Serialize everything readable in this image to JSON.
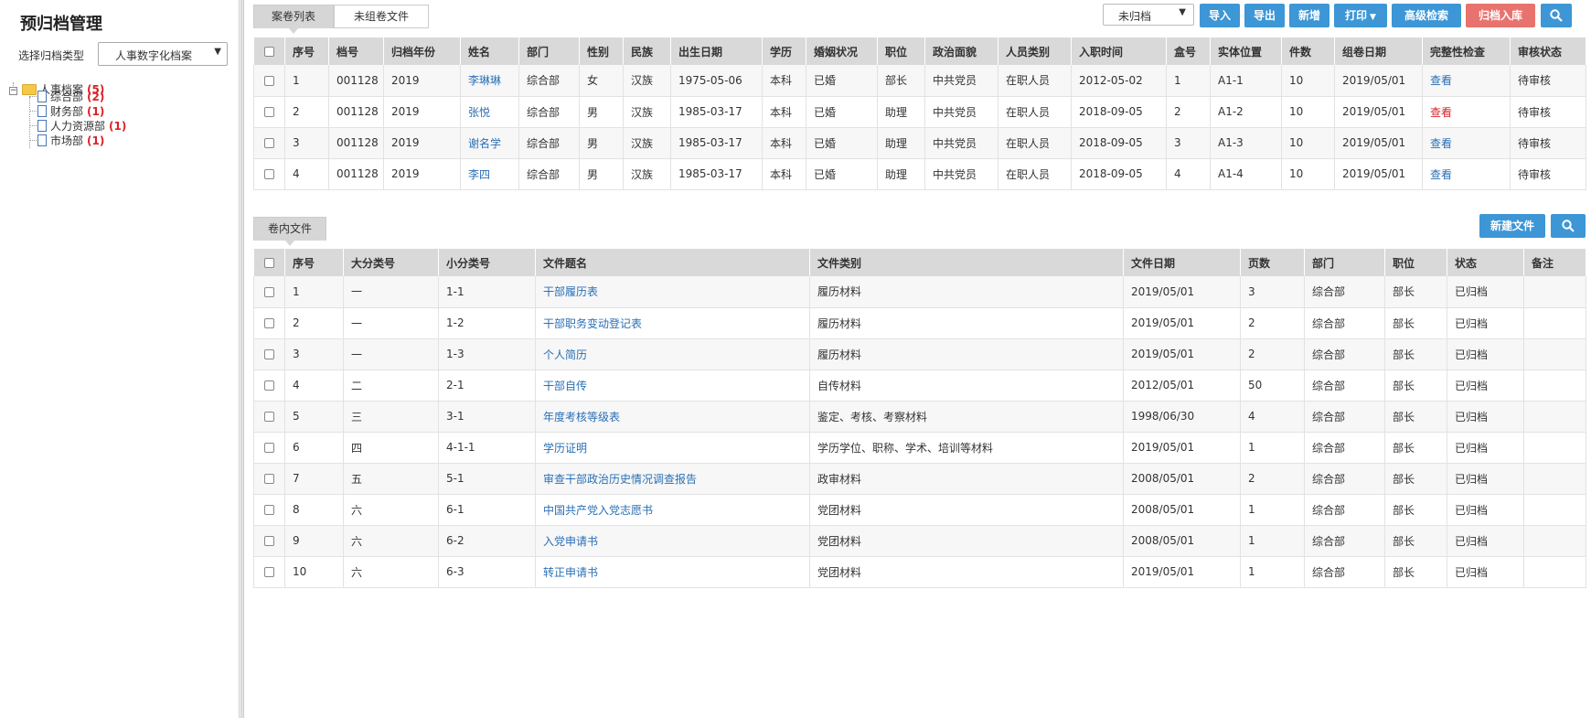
{
  "sidebar": {
    "title": "预归档管理",
    "select_label": "选择归档类型",
    "select_value": "人事数字化档案",
    "tree": {
      "root": {
        "label": "人事档案",
        "count": "(5)"
      },
      "children": [
        {
          "label": "综合部",
          "count": "(2)"
        },
        {
          "label": "财务部",
          "count": "(1)"
        },
        {
          "label": "人力资源部",
          "count": "(1)"
        },
        {
          "label": "市场部",
          "count": "(1)"
        }
      ]
    }
  },
  "top": {
    "tabs": [
      {
        "label": "案卷列表"
      },
      {
        "label": "未组卷文件"
      }
    ],
    "status_select": "未归档",
    "buttons": {
      "import": "导入",
      "export": "导出",
      "add": "新增",
      "print": "打印",
      "advanced_search": "高级检索",
      "archive": "归档入库"
    },
    "columns": [
      "序号",
      "档号",
      "归档年份",
      "姓名",
      "部门",
      "性别",
      "民族",
      "出生日期",
      "学历",
      "婚姻状况",
      "职位",
      "政治面貌",
      "人员类别",
      "入职时间",
      "盒号",
      "实体位置",
      "件数",
      "组卷日期",
      "完整性检查",
      "审核状态"
    ],
    "rows": [
      [
        "1",
        "001128",
        "2019",
        "李琳琳",
        "综合部",
        "女",
        "汉族",
        "1975-05-06",
        "本科",
        "已婚",
        "部长",
        "中共党员",
        "在职人员",
        "2012-05-02",
        "1",
        "A1-1",
        "10",
        "2019/05/01",
        "查看",
        "待审核"
      ],
      [
        "2",
        "001128",
        "2019",
        "张悦",
        "综合部",
        "男",
        "汉族",
        "1985-03-17",
        "本科",
        "已婚",
        "助理",
        "中共党员",
        "在职人员",
        "2018-09-05",
        "2",
        "A1-2",
        "10",
        "2019/05/01",
        "查看",
        "待审核"
      ],
      [
        "3",
        "001128",
        "2019",
        "谢名学",
        "综合部",
        "男",
        "汉族",
        "1985-03-17",
        "本科",
        "已婚",
        "助理",
        "中共党员",
        "在职人员",
        "2018-09-05",
        "3",
        "A1-3",
        "10",
        "2019/05/01",
        "查看",
        "待审核"
      ],
      [
        "4",
        "001128",
        "2019",
        "李四",
        "综合部",
        "男",
        "汉族",
        "1985-03-17",
        "本科",
        "已婚",
        "助理",
        "中共党员",
        "在职人员",
        "2018-09-05",
        "4",
        "A1-4",
        "10",
        "2019/05/01",
        "查看",
        "待审核"
      ]
    ]
  },
  "bottom": {
    "tab": "卷内文件",
    "new_file_button": "新建文件",
    "columns": [
      "序号",
      "大分类号",
      "小分类号",
      "文件题名",
      "文件类别",
      "文件日期",
      "页数",
      "部门",
      "职位",
      "状态",
      "备注"
    ],
    "rows": [
      [
        "1",
        "一",
        "1-1",
        "干部履历表",
        "履历材料",
        "2019/05/01",
        "3",
        "综合部",
        "部长",
        "已归档",
        ""
      ],
      [
        "2",
        "一",
        "1-2",
        "干部职务变动登记表",
        "履历材料",
        "2019/05/01",
        "2",
        "综合部",
        "部长",
        "已归档",
        ""
      ],
      [
        "3",
        "一",
        "1-3",
        "个人简历",
        "履历材料",
        "2019/05/01",
        "2",
        "综合部",
        "部长",
        "已归档",
        ""
      ],
      [
        "4",
        "二",
        "2-1",
        "干部自传",
        "自传材料",
        "2012/05/01",
        "50",
        "综合部",
        "部长",
        "已归档",
        ""
      ],
      [
        "5",
        "三",
        "3-1",
        "年度考核等级表",
        "鉴定、考核、考察材料",
        "1998/06/30",
        "4",
        "综合部",
        "部长",
        "已归档",
        ""
      ],
      [
        "6",
        "四",
        "4-1-1",
        "学历证明",
        "学历学位、职称、学术、培训等材料",
        "2019/05/01",
        "1",
        "综合部",
        "部长",
        "已归档",
        ""
      ],
      [
        "7",
        "五",
        "5-1",
        "审查干部政治历史情况调查报告",
        "政审材料",
        "2008/05/01",
        "2",
        "综合部",
        "部长",
        "已归档",
        ""
      ],
      [
        "8",
        "六",
        "6-1",
        "中国共产党入党志愿书",
        "党团材料",
        "2008/05/01",
        "1",
        "综合部",
        "部长",
        "已归档",
        ""
      ],
      [
        "9",
        "六",
        "6-2",
        "入党申请书",
        "党团材料",
        "2008/05/01",
        "1",
        "综合部",
        "部长",
        "已归档",
        ""
      ],
      [
        "10",
        "六",
        "6-3",
        "转正申请书",
        "党团材料",
        "2019/05/01",
        "1",
        "综合部",
        "部长",
        "已归档",
        ""
      ]
    ]
  },
  "colors": {
    "accent": "#3d96d6",
    "danger": "#e8736e",
    "link": "#2a6fb4",
    "red_text": "#d9232a"
  }
}
